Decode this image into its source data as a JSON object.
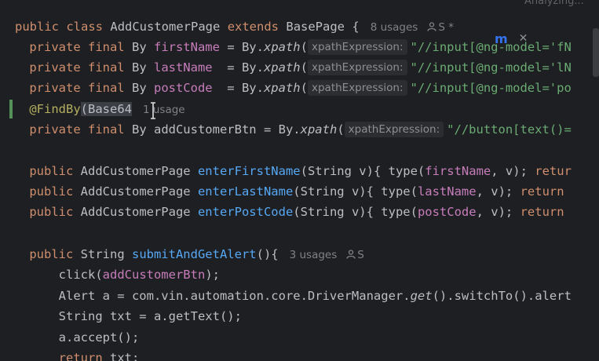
{
  "top_right_label": "Analyzing...",
  "lines": {
    "l1": {
      "public": "public",
      "class": "class",
      "classname": "AddCustomerPage",
      "extends": "extends",
      "base": "BasePage",
      "brace": " {",
      "usages": "8 usages",
      "author": "S *"
    },
    "l2": {
      "indent": "    ",
      "mods": "private final",
      "type": " By ",
      "field": "firstName",
      "eq": " = By.",
      "mth": "xpath",
      "paren": "(",
      "hint": "xpathExpression:",
      "str": "\"//input[@ng-model='fN"
    },
    "l3": {
      "indent": "    ",
      "mods": "private final",
      "type": " By ",
      "field": "lastName",
      "eq": "  = By.",
      "mth": "xpath",
      "paren": "(",
      "hint": "xpathExpression:",
      "str": "\"//input[@ng-model='lN"
    },
    "l4": {
      "indent": "    ",
      "mods": "private final",
      "type": " By ",
      "field": "postCode",
      "eq": "  = By.",
      "mth": "xpath",
      "paren": "(",
      "hint": "xpathExpression:",
      "str": "\"//input[@ng-model='po"
    },
    "l5": {
      "indent": "    ",
      "ann": "@FindBy",
      "rest": "(Base64",
      "usages": "1 usage"
    },
    "l6": {
      "indent": "    ",
      "mods": "private final",
      "type": " By ",
      "field": "addCustomerBtn",
      "eq": " = By.",
      "mth": "xpath",
      "paren": "(",
      "hint": "xpathExpression:",
      "str": "\"//button[text()="
    },
    "l8": {
      "indent": "    ",
      "public": "public",
      "ret": " AddCustomerPage ",
      "mth": "enterFirstName",
      "args": "(String v){ type(",
      "field": "firstName",
      "tail": ", v); ",
      "ret2": "retur"
    },
    "l9": {
      "indent": "    ",
      "public": "public",
      "ret": " AddCustomerPage ",
      "mth": "enterLastName",
      "args": "(String v){ type(",
      "field": "lastName",
      "tail": ", v); ",
      "ret2": "return"
    },
    "l10": {
      "indent": "    ",
      "public": "public",
      "ret": " AddCustomerPage ",
      "mth": "enterPostCode",
      "args": "(String v){ type(",
      "field": "postCode",
      "tail": ", v); ",
      "ret2": "return"
    },
    "l12": {
      "indent": "    ",
      "public": "public",
      "ret": " String ",
      "mth": "submitAndGetAlert",
      "args": "(){",
      "usages": "3 usages",
      "author": "S"
    },
    "l13": {
      "indent": "        ",
      "call": "click(",
      "field": "addCustomerBtn",
      "tail": ");"
    },
    "l14": {
      "indent": "        ",
      "pre": "Alert a = com.vin.automation.core.DriverManager.",
      "mth": "get",
      "tail": "().switchTo().alert"
    },
    "l15": {
      "indent": "        ",
      "text": "String txt = a.getText();"
    },
    "l16": {
      "indent": "        ",
      "text": "a.accept();"
    },
    "l17": {
      "indent": "        ",
      "kw": "return",
      "text": " txt;"
    }
  }
}
